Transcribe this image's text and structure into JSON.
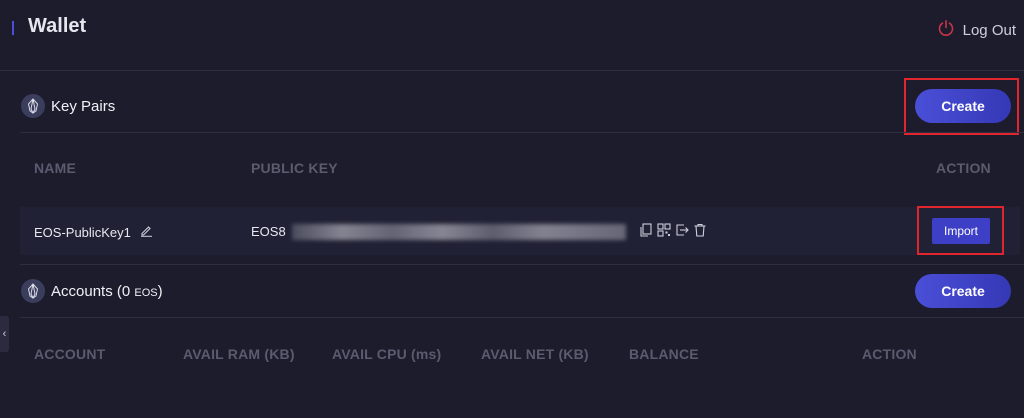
{
  "header": {
    "title": "Wallet",
    "logout_label": "Log Out"
  },
  "key_pairs": {
    "title": "Key Pairs",
    "create_label": "Create",
    "columns": {
      "name": "NAME",
      "public_key": "PUBLIC KEY",
      "action": "ACTION"
    },
    "rows": [
      {
        "name": "EOS-PublicKey1",
        "public_key_prefix": "EOS8",
        "action_label": "Import"
      }
    ]
  },
  "accounts": {
    "title": "Accounts (0 ",
    "unit": "EOS",
    "title_end": ")",
    "create_label": "Create",
    "columns": {
      "account": "ACCOUNT",
      "avail_ram": "AVAIL RAM (KB)",
      "avail_cpu": "AVAIL CPU (ms)",
      "avail_net": "AVAIL NET (KB)",
      "balance": "BALANCE",
      "action": "ACTION"
    }
  },
  "sidebar_toggle": {
    "glyph": "‹"
  },
  "colors": {
    "background": "#1c1c2d",
    "accent": "#4a4fd8",
    "highlight": "#e0262c",
    "logout_icon": "#c8344a"
  },
  "icons": [
    "power-icon",
    "eos-logo-icon",
    "edit-icon",
    "copy-icon",
    "qr-code-icon",
    "export-icon",
    "trash-icon"
  ]
}
